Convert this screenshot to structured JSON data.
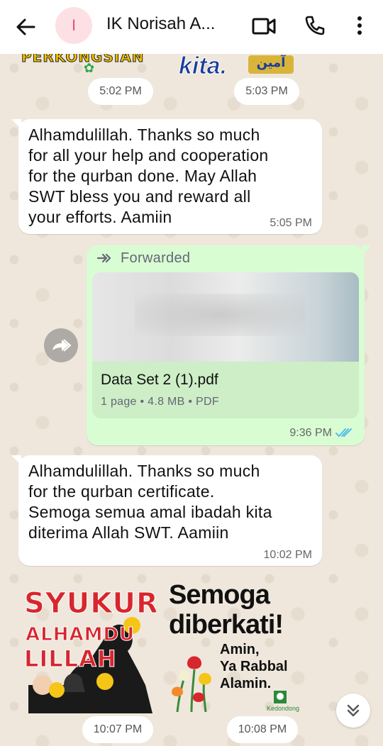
{
  "header": {
    "avatar_initial": "I",
    "contact_name": "IK Norisah A..."
  },
  "top_stickers": {
    "left_text": "PERKONGSIAN",
    "right_text": "kita.",
    "right_arabic": "آمين"
  },
  "timestamps": {
    "sticker_left": "5:02 PM",
    "sticker_right": "5:03 PM",
    "sticker_bottom_left": "10:07 PM",
    "sticker_bottom_right": "10:08 PM"
  },
  "messages": [
    {
      "direction": "incoming",
      "text": "Alhamdulillah. Thanks so much\nfor all your help and cooperation\nfor the qurban done. May Allah\nSWT bless you and reward all\nyour efforts. Aamiin",
      "time": "5:05 PM"
    },
    {
      "direction": "outgoing",
      "forwarded_label": "Forwarded",
      "file_name": "Data Set 2 (1).pdf",
      "file_meta": "1 page • 4.8 MB • PDF",
      "time": "9:36 PM",
      "status": "read"
    },
    {
      "direction": "incoming",
      "text": "Alhamdulillah. Thanks so much\nfor the qurban certificate.\nSemoga semua amal ibadah kita\nditerima Allah SWT. Aamiin",
      "time": "10:02 PM"
    }
  ],
  "bottom_stickers": {
    "left_lines": [
      "SYUKUR",
      "ALHAMDU",
      "LILLAH"
    ],
    "right_title": "Semoga\ndiberkati!",
    "right_sub": "Amin,\nYa Rabbal\nAlamin.",
    "right_brand": "Kedondong"
  },
  "colors": {
    "header_bg": "#ffffff",
    "wallpaper": "#efe7dc",
    "incoming_bubble": "#ffffff",
    "outgoing_bubble": "#d9fdd3",
    "read_ticks": "#53bdeb",
    "avatar_bg": "#fde0e4",
    "avatar_fg": "#e0566c"
  },
  "icons": {
    "back": "arrow-left-icon",
    "video": "video-camera-icon",
    "call": "phone-icon",
    "menu": "more-vert-icon",
    "forward": "forward-icon",
    "share": "share-forward-icon",
    "scroll_down": "double-chevron-down-icon"
  }
}
